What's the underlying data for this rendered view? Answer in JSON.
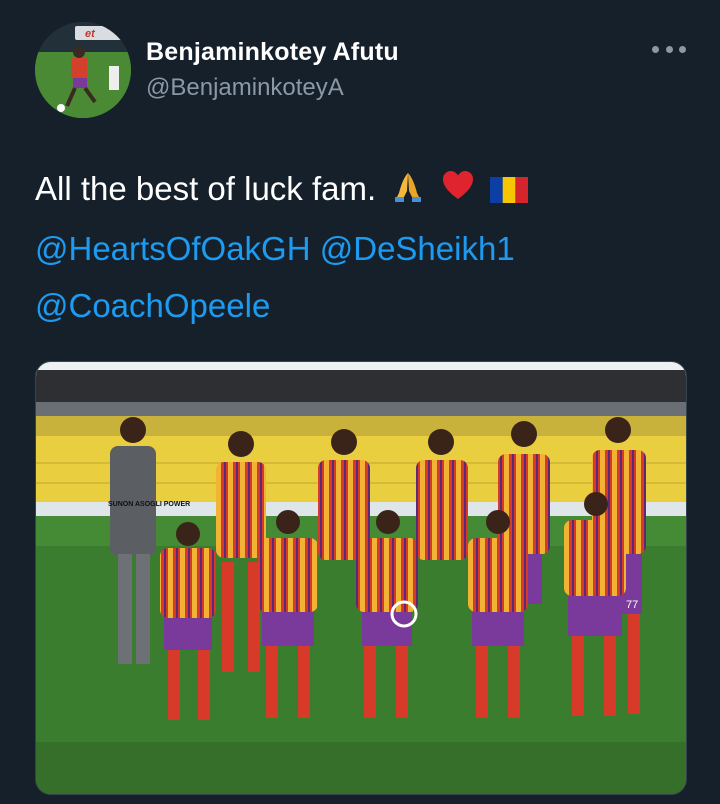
{
  "author": {
    "display_name": "Benjaminkotey Afutu",
    "handle": "@BenjaminkoteyA",
    "avatar_sign_text": "et"
  },
  "tweet": {
    "text": "All the best of luck fam.",
    "emojis": [
      "folded-hands",
      "red-heart",
      "flag-romania"
    ],
    "mentions": [
      "@HeartsOfOakGH",
      "@DeSheikh1",
      "@CoachOpeele"
    ]
  },
  "media": {
    "jersey_sponsor": "SUNON ASOGLI POWER",
    "shirt_number": "77"
  },
  "colors": {
    "background": "#15202b",
    "link": "#1d9bf0",
    "secondary_text": "#8b98a5"
  }
}
